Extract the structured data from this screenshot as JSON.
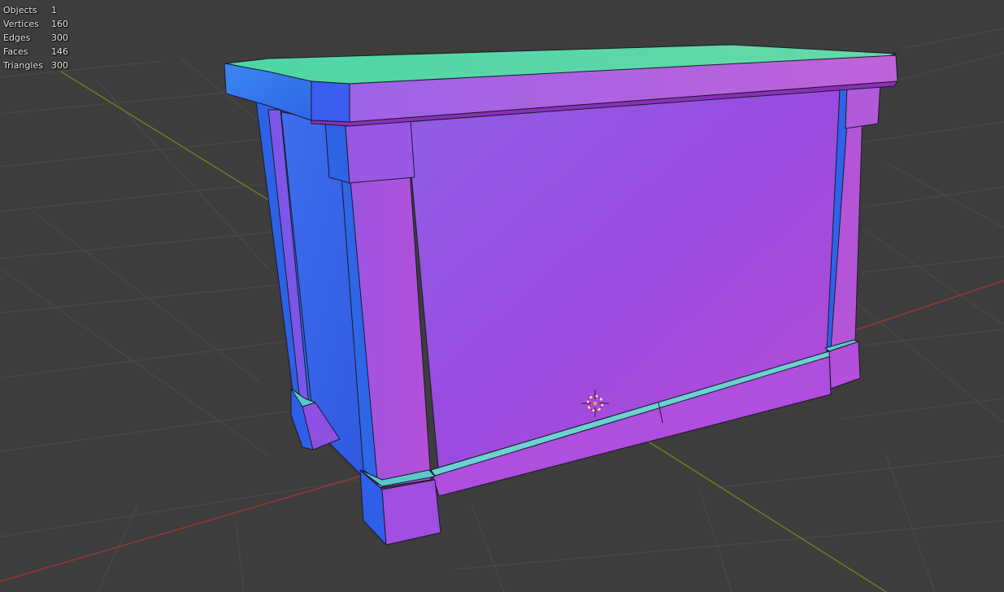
{
  "stats": {
    "objects": {
      "label": "Objects",
      "value": "1"
    },
    "vertices": {
      "label": "Vertices",
      "value": "160"
    },
    "edges": {
      "label": "Edges",
      "value": "300"
    },
    "faces": {
      "label": "Faces",
      "value": "146"
    },
    "triangles": {
      "label": "Triangles",
      "value": "300"
    }
  },
  "viewport": {
    "background_color": "#3d3d3d",
    "grid_color": "#4a4a4a",
    "x_axis_color": "#b23b3b",
    "y_axis_color": "#6f8a22",
    "shading": "normal-map-matcap",
    "cursor_icon": "3d-cursor-icon"
  }
}
